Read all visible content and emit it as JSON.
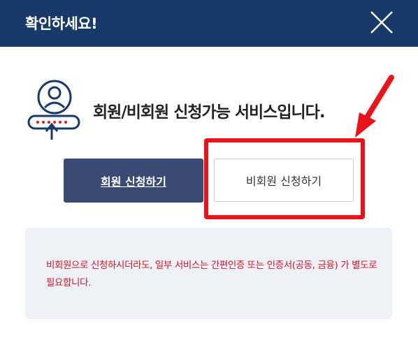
{
  "dialog": {
    "title": "확인하세요!",
    "headline": "회원/비회원 신청가능 서비스입니다.",
    "member_button": "회원 신청하기",
    "nonmember_button": "비회원 신청하기",
    "notice": "비회원으로 신청하시더라도, 일부 서비스는 간편인증 또는 인증서(공동, 금융) 가 별도로 필요합니다."
  },
  "icons": [
    "close-icon",
    "user-login-icon",
    "red-arrow-icon"
  ],
  "colors": {
    "header": "#173a6a",
    "member_button": "#3a4a72",
    "highlight": "#e8141a",
    "notice_text": "#d0142c",
    "notice_bg": "#eef2f6"
  }
}
